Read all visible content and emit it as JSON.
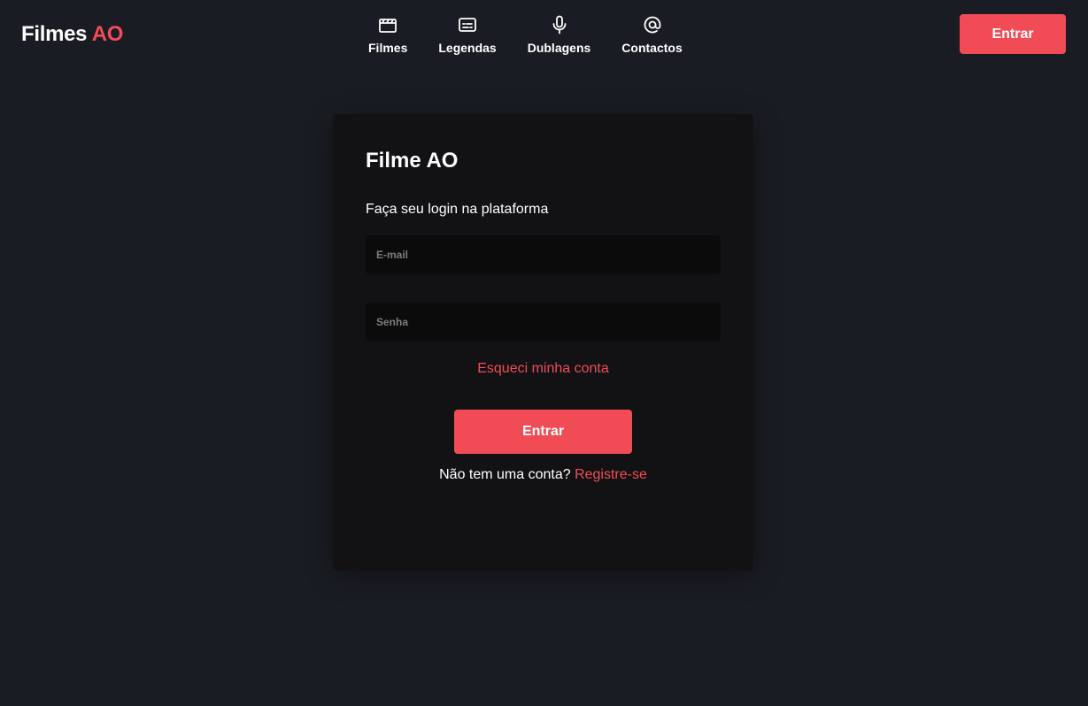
{
  "header": {
    "logo": {
      "main": "Filmes ",
      "accent": "AO"
    },
    "nav": [
      {
        "label": "Filmes",
        "icon": "clapperboard-icon"
      },
      {
        "label": "Legendas",
        "icon": "subtitles-icon"
      },
      {
        "label": "Dublagens",
        "icon": "microphone-icon"
      },
      {
        "label": "Contactos",
        "icon": "at-sign-icon"
      }
    ],
    "login_button": "Entrar"
  },
  "login": {
    "title": "Filme AO",
    "subtitle": "Faça seu login na plataforma",
    "email_placeholder": "E-mail",
    "password_placeholder": "Senha",
    "forgot_link": "Esqueci minha conta",
    "submit_label": "Entrar",
    "no_account_text": "Não tem uma conta? ",
    "register_link": "Registre-se"
  },
  "colors": {
    "background": "#191c22",
    "card": "#121214",
    "input": "#0b0b0c",
    "accent": "#f14c56"
  }
}
